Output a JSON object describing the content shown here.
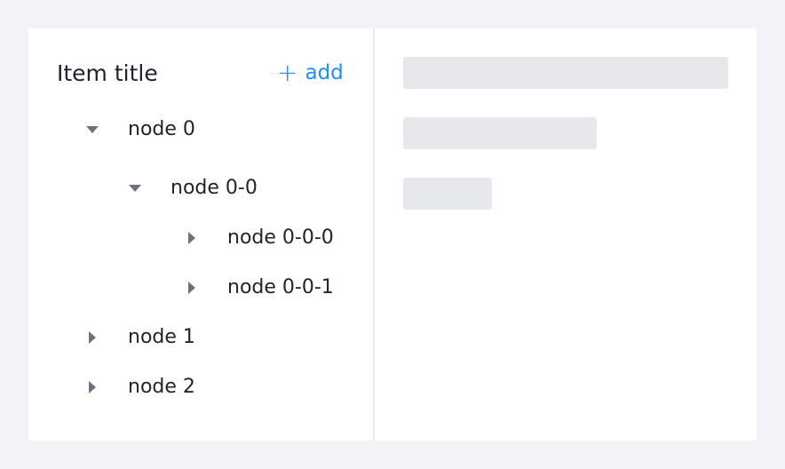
{
  "panel": {
    "title": "Item title",
    "add_label": "add",
    "add_icon": "+"
  },
  "tree": [
    {
      "label": "node 0",
      "expanded": true,
      "level": 0
    },
    {
      "label": "node 0-0",
      "expanded": true,
      "level": 1
    },
    {
      "label": "node 0-0-0",
      "expanded": false,
      "level": 2
    },
    {
      "label": "node 0-0-1",
      "expanded": false,
      "level": 2
    },
    {
      "label": "node 1",
      "expanded": false,
      "level": 0
    },
    {
      "label": "node 2",
      "expanded": false,
      "level": 0
    }
  ],
  "colors": {
    "accent": "#1f8cff",
    "background": "#f2f3f6",
    "skeleton": "#e6e8ec",
    "caret": "#6b7280"
  }
}
